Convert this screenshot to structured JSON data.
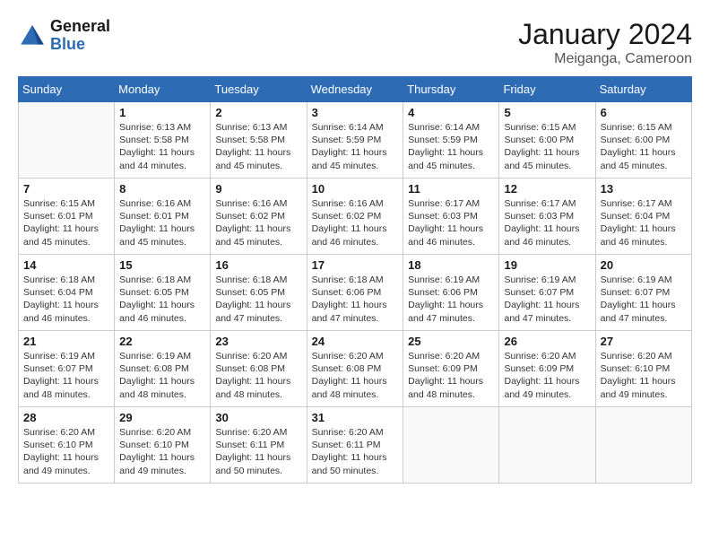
{
  "logo": {
    "line1": "General",
    "line2": "Blue"
  },
  "title": "January 2024",
  "subtitle": "Meiganga, Cameroon",
  "days_of_week": [
    "Sunday",
    "Monday",
    "Tuesday",
    "Wednesday",
    "Thursday",
    "Friday",
    "Saturday"
  ],
  "weeks": [
    [
      {
        "day": "",
        "sunrise": "",
        "sunset": "",
        "daylight": ""
      },
      {
        "day": "1",
        "sunrise": "Sunrise: 6:13 AM",
        "sunset": "Sunset: 5:58 PM",
        "daylight": "Daylight: 11 hours and 44 minutes."
      },
      {
        "day": "2",
        "sunrise": "Sunrise: 6:13 AM",
        "sunset": "Sunset: 5:58 PM",
        "daylight": "Daylight: 11 hours and 45 minutes."
      },
      {
        "day": "3",
        "sunrise": "Sunrise: 6:14 AM",
        "sunset": "Sunset: 5:59 PM",
        "daylight": "Daylight: 11 hours and 45 minutes."
      },
      {
        "day": "4",
        "sunrise": "Sunrise: 6:14 AM",
        "sunset": "Sunset: 5:59 PM",
        "daylight": "Daylight: 11 hours and 45 minutes."
      },
      {
        "day": "5",
        "sunrise": "Sunrise: 6:15 AM",
        "sunset": "Sunset: 6:00 PM",
        "daylight": "Daylight: 11 hours and 45 minutes."
      },
      {
        "day": "6",
        "sunrise": "Sunrise: 6:15 AM",
        "sunset": "Sunset: 6:00 PM",
        "daylight": "Daylight: 11 hours and 45 minutes."
      }
    ],
    [
      {
        "day": "7",
        "sunrise": "Sunrise: 6:15 AM",
        "sunset": "Sunset: 6:01 PM",
        "daylight": "Daylight: 11 hours and 45 minutes."
      },
      {
        "day": "8",
        "sunrise": "Sunrise: 6:16 AM",
        "sunset": "Sunset: 6:01 PM",
        "daylight": "Daylight: 11 hours and 45 minutes."
      },
      {
        "day": "9",
        "sunrise": "Sunrise: 6:16 AM",
        "sunset": "Sunset: 6:02 PM",
        "daylight": "Daylight: 11 hours and 45 minutes."
      },
      {
        "day": "10",
        "sunrise": "Sunrise: 6:16 AM",
        "sunset": "Sunset: 6:02 PM",
        "daylight": "Daylight: 11 hours and 46 minutes."
      },
      {
        "day": "11",
        "sunrise": "Sunrise: 6:17 AM",
        "sunset": "Sunset: 6:03 PM",
        "daylight": "Daylight: 11 hours and 46 minutes."
      },
      {
        "day": "12",
        "sunrise": "Sunrise: 6:17 AM",
        "sunset": "Sunset: 6:03 PM",
        "daylight": "Daylight: 11 hours and 46 minutes."
      },
      {
        "day": "13",
        "sunrise": "Sunrise: 6:17 AM",
        "sunset": "Sunset: 6:04 PM",
        "daylight": "Daylight: 11 hours and 46 minutes."
      }
    ],
    [
      {
        "day": "14",
        "sunrise": "Sunrise: 6:18 AM",
        "sunset": "Sunset: 6:04 PM",
        "daylight": "Daylight: 11 hours and 46 minutes."
      },
      {
        "day": "15",
        "sunrise": "Sunrise: 6:18 AM",
        "sunset": "Sunset: 6:05 PM",
        "daylight": "Daylight: 11 hours and 46 minutes."
      },
      {
        "day": "16",
        "sunrise": "Sunrise: 6:18 AM",
        "sunset": "Sunset: 6:05 PM",
        "daylight": "Daylight: 11 hours and 47 minutes."
      },
      {
        "day": "17",
        "sunrise": "Sunrise: 6:18 AM",
        "sunset": "Sunset: 6:06 PM",
        "daylight": "Daylight: 11 hours and 47 minutes."
      },
      {
        "day": "18",
        "sunrise": "Sunrise: 6:19 AM",
        "sunset": "Sunset: 6:06 PM",
        "daylight": "Daylight: 11 hours and 47 minutes."
      },
      {
        "day": "19",
        "sunrise": "Sunrise: 6:19 AM",
        "sunset": "Sunset: 6:07 PM",
        "daylight": "Daylight: 11 hours and 47 minutes."
      },
      {
        "day": "20",
        "sunrise": "Sunrise: 6:19 AM",
        "sunset": "Sunset: 6:07 PM",
        "daylight": "Daylight: 11 hours and 47 minutes."
      }
    ],
    [
      {
        "day": "21",
        "sunrise": "Sunrise: 6:19 AM",
        "sunset": "Sunset: 6:07 PM",
        "daylight": "Daylight: 11 hours and 48 minutes."
      },
      {
        "day": "22",
        "sunrise": "Sunrise: 6:19 AM",
        "sunset": "Sunset: 6:08 PM",
        "daylight": "Daylight: 11 hours and 48 minutes."
      },
      {
        "day": "23",
        "sunrise": "Sunrise: 6:20 AM",
        "sunset": "Sunset: 6:08 PM",
        "daylight": "Daylight: 11 hours and 48 minutes."
      },
      {
        "day": "24",
        "sunrise": "Sunrise: 6:20 AM",
        "sunset": "Sunset: 6:08 PM",
        "daylight": "Daylight: 11 hours and 48 minutes."
      },
      {
        "day": "25",
        "sunrise": "Sunrise: 6:20 AM",
        "sunset": "Sunset: 6:09 PM",
        "daylight": "Daylight: 11 hours and 48 minutes."
      },
      {
        "day": "26",
        "sunrise": "Sunrise: 6:20 AM",
        "sunset": "Sunset: 6:09 PM",
        "daylight": "Daylight: 11 hours and 49 minutes."
      },
      {
        "day": "27",
        "sunrise": "Sunrise: 6:20 AM",
        "sunset": "Sunset: 6:10 PM",
        "daylight": "Daylight: 11 hours and 49 minutes."
      }
    ],
    [
      {
        "day": "28",
        "sunrise": "Sunrise: 6:20 AM",
        "sunset": "Sunset: 6:10 PM",
        "daylight": "Daylight: 11 hours and 49 minutes."
      },
      {
        "day": "29",
        "sunrise": "Sunrise: 6:20 AM",
        "sunset": "Sunset: 6:10 PM",
        "daylight": "Daylight: 11 hours and 49 minutes."
      },
      {
        "day": "30",
        "sunrise": "Sunrise: 6:20 AM",
        "sunset": "Sunset: 6:11 PM",
        "daylight": "Daylight: 11 hours and 50 minutes."
      },
      {
        "day": "31",
        "sunrise": "Sunrise: 6:20 AM",
        "sunset": "Sunset: 6:11 PM",
        "daylight": "Daylight: 11 hours and 50 minutes."
      },
      {
        "day": "",
        "sunrise": "",
        "sunset": "",
        "daylight": ""
      },
      {
        "day": "",
        "sunrise": "",
        "sunset": "",
        "daylight": ""
      },
      {
        "day": "",
        "sunrise": "",
        "sunset": "",
        "daylight": ""
      }
    ]
  ]
}
